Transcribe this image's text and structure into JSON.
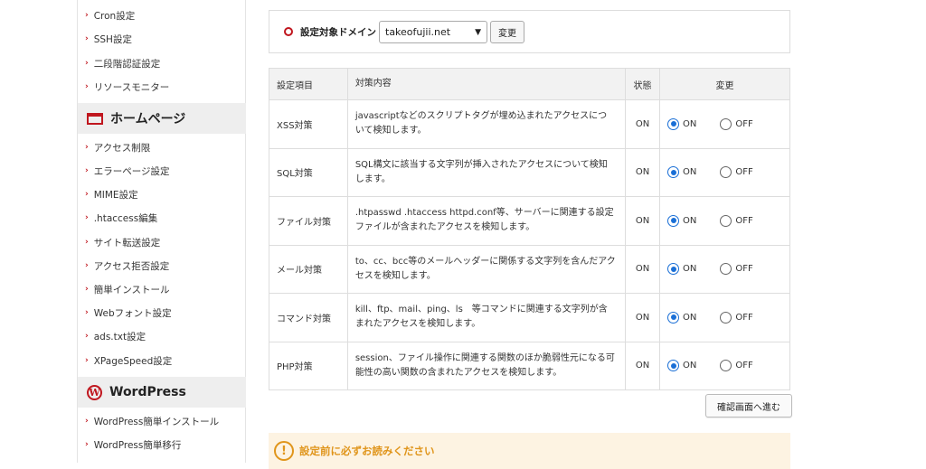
{
  "sidebar": {
    "items_top": [
      {
        "label": "Cron設定"
      },
      {
        "label": "SSH設定"
      },
      {
        "label": "二段階認証設定"
      },
      {
        "label": "リソースモニター"
      }
    ],
    "section_homepage": {
      "title": "ホームページ",
      "icon": "homepage-icon"
    },
    "items_homepage": [
      {
        "label": "アクセス制限"
      },
      {
        "label": "エラーページ設定"
      },
      {
        "label": "MIME設定"
      },
      {
        "label": ".htaccess編集"
      },
      {
        "label": "サイト転送設定"
      },
      {
        "label": "アクセス拒否設定"
      },
      {
        "label": "簡単インストール"
      },
      {
        "label": "Webフォント設定"
      },
      {
        "label": "ads.txt設定"
      },
      {
        "label": "XPageSpeed設定"
      }
    ],
    "section_wordpress": {
      "title": "WordPress",
      "icon": "wordpress-icon"
    },
    "items_wordpress": [
      {
        "label": "WordPress簡単インストール"
      },
      {
        "label": "WordPress簡単移行"
      }
    ]
  },
  "domain_selector": {
    "label": "設定対象ドメイン",
    "selected": "takeofujii.net",
    "change_button": "変更"
  },
  "table": {
    "headers": {
      "item": "設定項目",
      "desc": "対策内容",
      "state": "状態",
      "change": "変更"
    },
    "on_label": "ON",
    "off_label": "OFF",
    "rows": [
      {
        "item": "XSS対策",
        "desc": "javascriptなどのスクリプトタグが埋め込まれたアクセスについて検知します。",
        "state": "ON",
        "selected": "ON"
      },
      {
        "item": "SQL対策",
        "desc": "SQL構文に該当する文字列が挿入されたアクセスについて検知します。",
        "state": "ON",
        "selected": "ON"
      },
      {
        "item": "ファイル対策",
        "desc": ".htpasswd .htaccess httpd.conf等、サーバーに関連する設定ファイルが含まれたアクセスを検知します。",
        "state": "ON",
        "selected": "ON"
      },
      {
        "item": "メール対策",
        "desc": "to、cc、bcc等のメールヘッダーに関係する文字列を含んだアクセスを検知します。",
        "state": "ON",
        "selected": "ON"
      },
      {
        "item": "コマンド対策",
        "desc": "kill、ftp、mail、ping、ls　等コマンドに関連する文字列が含まれたアクセスを検知します。",
        "state": "ON",
        "selected": "ON"
      },
      {
        "item": "PHP対策",
        "desc": "session、ファイル操作に関連する関数のほか脆弱性元になる可能性の高い関数の含まれたアクセスを検知します。",
        "state": "ON",
        "selected": "ON"
      }
    ]
  },
  "confirm_button": "確認画面へ進む",
  "notice": {
    "text": "設定前に必ずお読みください"
  },
  "colors": {
    "accent_red": "#c0161e",
    "radio_blue": "#1a6fd6",
    "notice_orange": "#e0951b"
  }
}
